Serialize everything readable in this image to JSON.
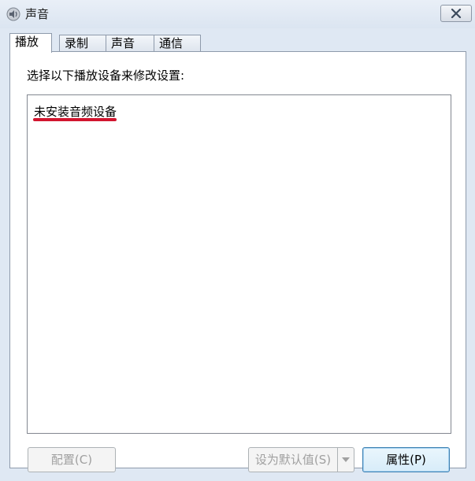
{
  "window": {
    "title": "声音",
    "title_icon": "speaker-icon",
    "close_icon": "close-icon"
  },
  "tabs": [
    {
      "label": "播放",
      "active": true
    },
    {
      "label": "录制",
      "active": false
    },
    {
      "label": "声音",
      "active": false
    },
    {
      "label": "通信",
      "active": false
    }
  ],
  "playback": {
    "instruction": "选择以下播放设备来修改设置:",
    "empty_message": "未安装音频设备",
    "highlight_color": "#d2152e"
  },
  "buttons": {
    "configure": "配置(C)",
    "set_default": "设为默认值(S)",
    "set_default_dropdown_icon": "triangle-down-icon",
    "properties": "属性(P)"
  }
}
